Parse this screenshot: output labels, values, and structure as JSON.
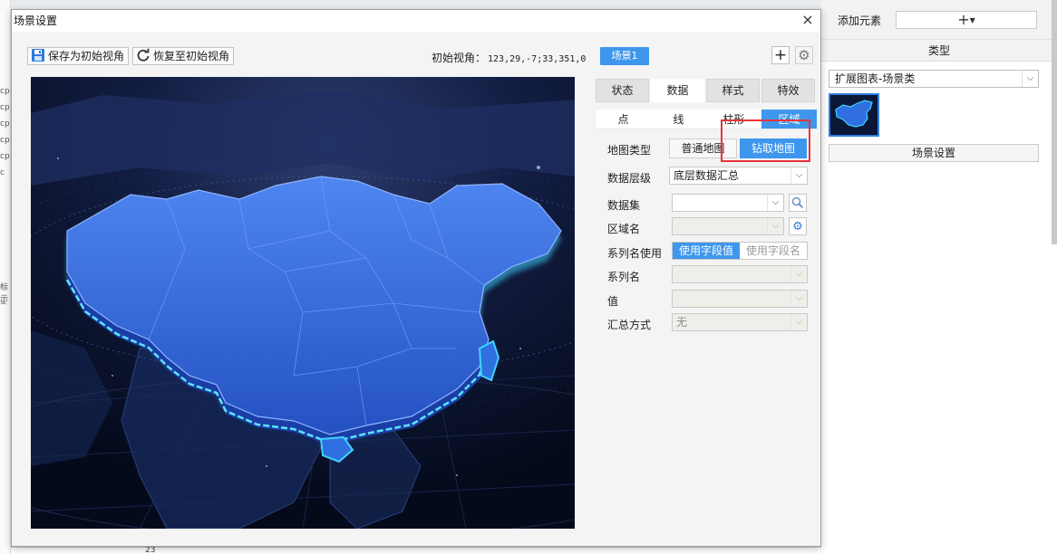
{
  "background": {
    "left_fragments": [
      "cp",
      "cp",
      "cp",
      "cp",
      "cp",
      "c",
      "标示",
      "="
    ],
    "bottom_fragment": "23"
  },
  "dialog": {
    "title": "场景设置",
    "close_symbol": "×"
  },
  "toolbar": {
    "save_view_label": "保存为初始视角",
    "restore_view_label": "恢复至初始视角",
    "initial_view_label": "初始视角：",
    "initial_view_value": "123,29,-7;33,351,0",
    "scene_tab_label": "场景1",
    "add_symbol": "+",
    "settings_symbol": "⚙"
  },
  "tabs": {
    "main": [
      {
        "label": "状态",
        "active": false
      },
      {
        "label": "数据",
        "active": true
      },
      {
        "label": "样式",
        "active": false
      },
      {
        "label": "特效",
        "active": false
      }
    ],
    "sub": [
      {
        "label": "点",
        "active": false
      },
      {
        "label": "线",
        "active": false
      },
      {
        "label": "柱形",
        "active": false
      },
      {
        "label": "区域",
        "active": true
      }
    ]
  },
  "form": {
    "map_type": {
      "label": "地图类型",
      "options": [
        {
          "label": "普通地图",
          "active": false
        },
        {
          "label": "钻取地图",
          "active": true
        }
      ]
    },
    "data_level": {
      "label": "数据层级",
      "value": "底层数据汇总"
    },
    "dataset": {
      "label": "数据集",
      "value": ""
    },
    "region_name": {
      "label": "区域名",
      "value": ""
    },
    "series_name_use": {
      "label": "系列名使用",
      "options": [
        {
          "label": "使用字段值",
          "active": true
        },
        {
          "label": "使用字段名",
          "active": false
        }
      ]
    },
    "series_name": {
      "label": "系列名",
      "value": ""
    },
    "value": {
      "label": "值",
      "value": ""
    },
    "aggregate": {
      "label": "汇总方式",
      "value": "无"
    }
  },
  "right_panel": {
    "add_element_label": "添加元素",
    "add_symbol": "+",
    "type_title": "类型",
    "type_select_value": "扩展图表-场景类",
    "scene_settings_label": "场景设置"
  },
  "colors": {
    "accent": "#3e97ec",
    "highlight": "#e8343a",
    "map_glow": "#3fd3ff",
    "map_fill": "#2f6fe0",
    "preview_bg": "#070d22"
  }
}
